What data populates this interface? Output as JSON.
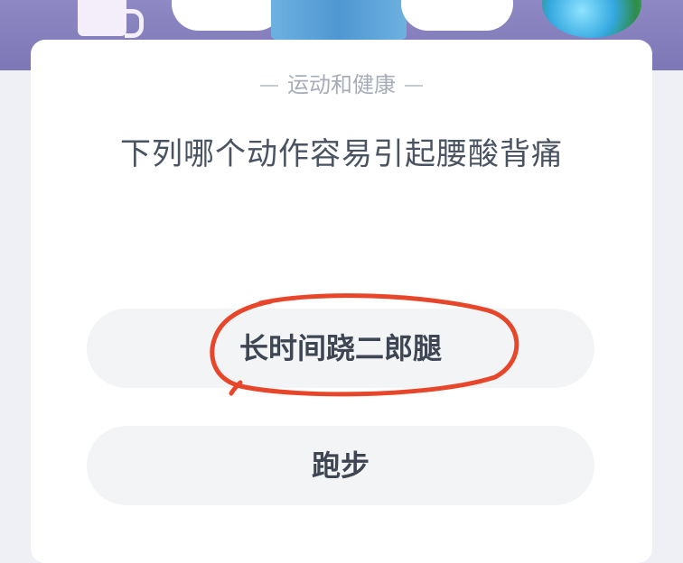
{
  "quiz": {
    "category": "运动和健康",
    "question": "下列哪个动作容易引起腰酸背痛",
    "options": [
      {
        "label": "长时间跷二郎腿"
      },
      {
        "label": "跑步"
      }
    ]
  },
  "colors": {
    "banner": "#8e88c4",
    "card": "#ffffff",
    "option_bg": "#f2f4f6",
    "annotation_stroke": "#e8462a"
  }
}
